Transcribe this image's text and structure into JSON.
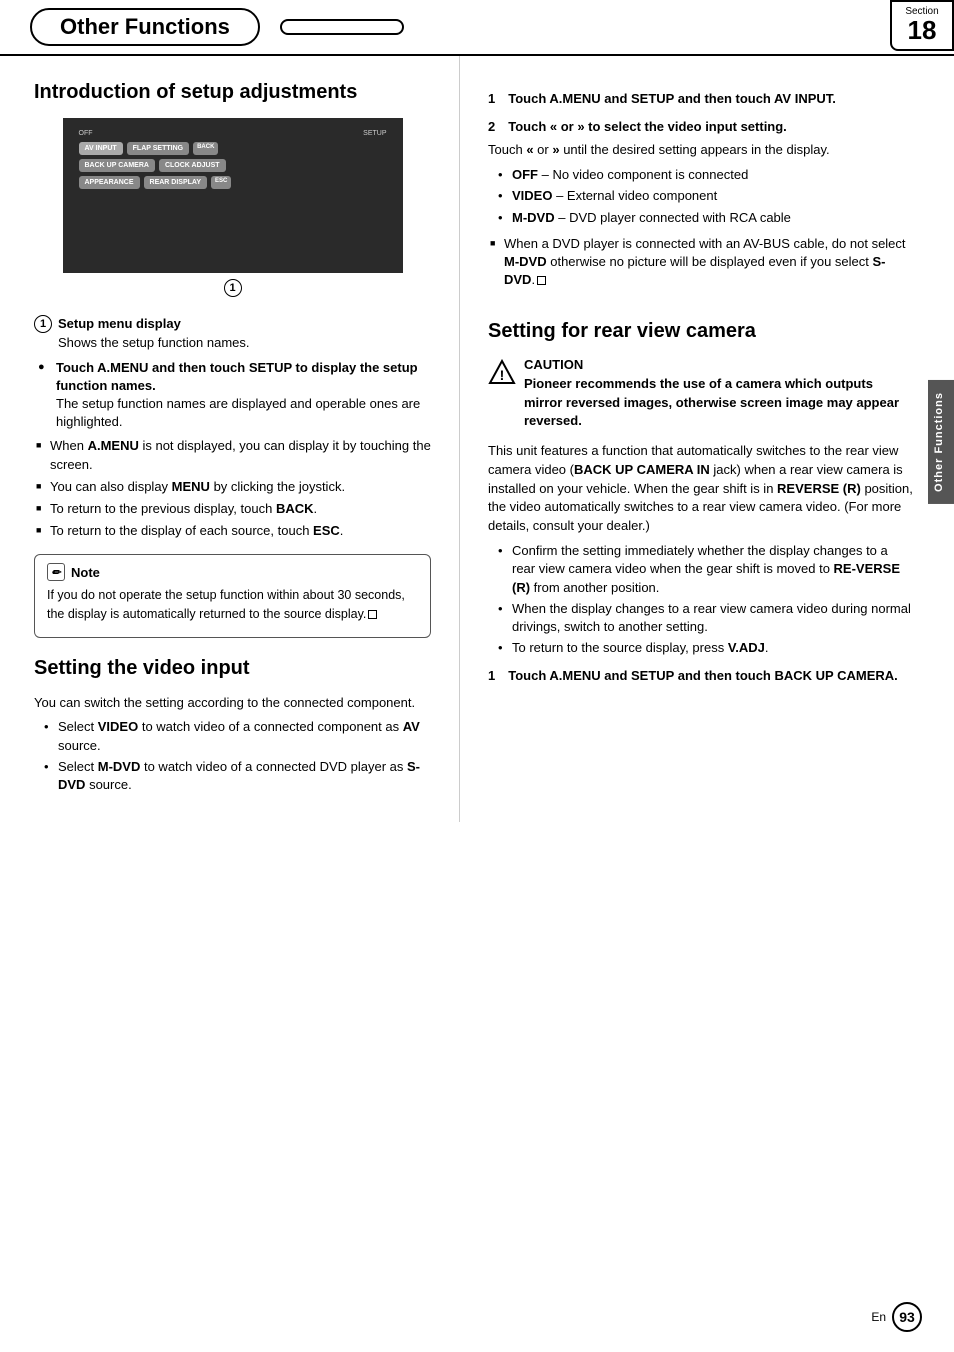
{
  "header": {
    "title": "Other Functions",
    "section_label": "Section",
    "section_number": "18"
  },
  "side_tab": {
    "label": "Other Functions"
  },
  "left": {
    "intro_heading": "Introduction of setup adjustments",
    "callout_1_label": "Setup menu display",
    "callout_1_text": "Shows the setup function names.",
    "touch_setup_heading": "Touch A.MENU and then touch SETUP to display the setup function names.",
    "touch_setup_body": "The setup function names are displayed and operable ones are highlighted.",
    "sq_bullets": [
      "When A.MENU is not displayed, you can display it by touching the screen.",
      "You can also display MENU by clicking the joystick.",
      "To return to the previous display, touch BACK.",
      "To return to the display of each source, touch ESC."
    ],
    "note_header": "Note",
    "note_body": "If you do not operate the setup function within about 30 seconds, the display is automatically returned to the source display.",
    "video_input_heading": "Setting the video input",
    "video_input_intro": "You can switch the setting according to the connected component.",
    "video_input_bullets": [
      {
        "text": "Select VIDEO to watch video of a connected component as AV source.",
        "bold_words": [
          "VIDEO",
          "AV"
        ]
      },
      {
        "text": "Select M-DVD to watch video of a connected DVD player as S-DVD source.",
        "bold_words": [
          "M-DVD",
          "S-DVD"
        ]
      }
    ],
    "step1_video_heading": "1 Touch A.MENU and SETUP and then touch AV INPUT.",
    "step2_video_heading": "2 Touch « or » to select the video input setting.",
    "step2_intro": "Touch « or » until the desired setting appears in the display.",
    "step2_bullets": [
      {
        "text": "OFF – No video component is connected",
        "bold_words": [
          "OFF"
        ]
      },
      {
        "text": "VIDEO – External video component",
        "bold_words": [
          "VIDEO"
        ]
      },
      {
        "text": "M-DVD – DVD player connected with RCA cable",
        "bold_words": [
          "M-DVD"
        ]
      }
    ],
    "sq_bullet_avbus": "When a DVD player is connected with an AV-BUS cable, do not select M-DVD otherwise no picture will be displayed even if you select S-DVD."
  },
  "right": {
    "rear_camera_heading": "Setting for rear view camera",
    "caution_label": "CAUTION",
    "caution_text": "Pioneer recommends the use of a camera which outputs mirror reversed images, otherwise screen image may appear reversed.",
    "body1": "This unit features a function that automatically switches to the rear view camera video (BACK UP CAMERA IN jack) when a rear view camera is installed on your vehicle. When the gear shift is in REVERSE (R) position, the video automatically switches to a rear view camera video. (For more details, consult your dealer.)",
    "rear_bullets": [
      {
        "text": "Confirm the setting immediately whether the display changes to a rear view camera video when the gear shift is moved to REVERSE (R) from another position.",
        "bold_words": [
          "RE-VERSE (R)"
        ]
      },
      {
        "text": "When the display changes to a rear view camera video during normal drivings, switch to another setting.",
        "bold_words": []
      },
      {
        "text": "To return to the source display, press V.ADJ.",
        "bold_words": [
          "V.ADJ"
        ]
      }
    ],
    "step1_rear_heading": "1 Touch A.MENU and SETUP and then touch BACK UP CAMERA."
  },
  "footer": {
    "lang": "En",
    "page": "93"
  },
  "device_screen": {
    "top_labels": [
      "OFF",
      "SETUP"
    ],
    "rows": [
      [
        "AV INPUT",
        "FLAP SETTING",
        "BACK"
      ],
      [
        "BACK UP CAMERA",
        "CLOCK ADJUST",
        ""
      ],
      [
        "APPEARANCE",
        "REAR DISPLAY",
        "ESC"
      ]
    ]
  }
}
